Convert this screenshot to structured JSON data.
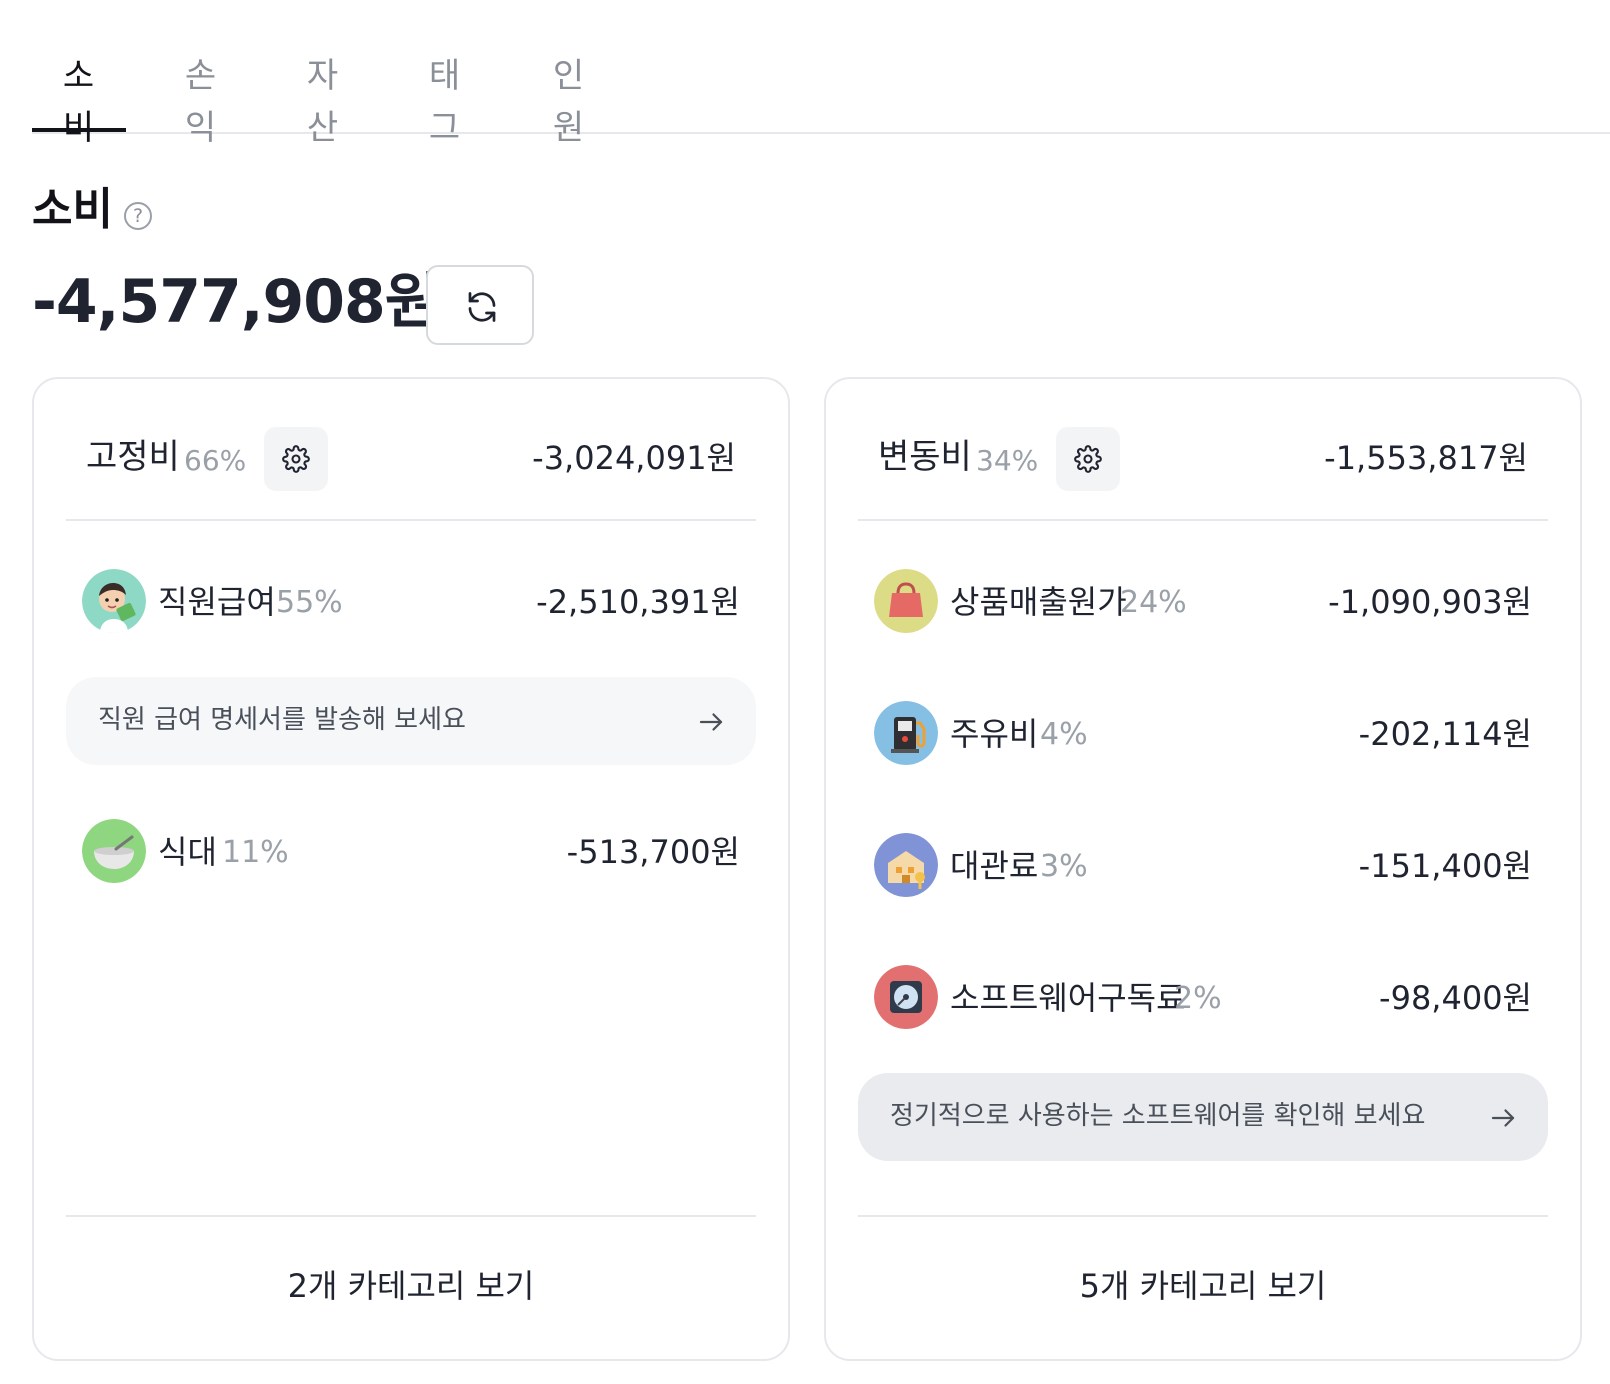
{
  "tabs": [
    {
      "label": "소비",
      "active": true
    },
    {
      "label": "손익",
      "active": false
    },
    {
      "label": "자산",
      "active": false
    },
    {
      "label": "태그",
      "active": false
    },
    {
      "label": "인원",
      "active": false
    }
  ],
  "header": {
    "title": "소비",
    "help_icon": "?",
    "total": "-4,577,908원"
  },
  "fixed": {
    "title": "고정비",
    "pct": "66%",
    "amount": "-3,024,091원",
    "items": [
      {
        "label": "직원급여",
        "pct": "55%",
        "amount": "-2,510,391원",
        "icon": "employee-icon"
      },
      {
        "label": "식대",
        "pct": "11%",
        "amount": "-513,700원",
        "icon": "meal-bowl-icon"
      }
    ],
    "banner": "직원 급여 명세서를 발송해 보세요",
    "footer": "2개 카테고리 보기"
  },
  "variable": {
    "title": "변동비",
    "pct": "34%",
    "amount": "-1,553,817원",
    "items": [
      {
        "label": "상품매출원가",
        "pct": "24%",
        "amount": "-1,090,903원",
        "icon": "shopping-bag-icon"
      },
      {
        "label": "주유비",
        "pct": "4%",
        "amount": "-202,114원",
        "icon": "fuel-pump-icon"
      },
      {
        "label": "대관료",
        "pct": "3%",
        "amount": "-151,400원",
        "icon": "building-key-icon"
      },
      {
        "label": "소프트웨어구독료",
        "pct": "2%",
        "amount": "-98,400원",
        "icon": "disc-icon"
      }
    ],
    "banner": "정기적으로 사용하는 소프트웨어를 확인해 보세요",
    "footer": "5개 카테고리 보기"
  },
  "colors": {
    "text": "#1f2430",
    "muted": "#9aa0a8",
    "border": "#e6e8ec"
  }
}
